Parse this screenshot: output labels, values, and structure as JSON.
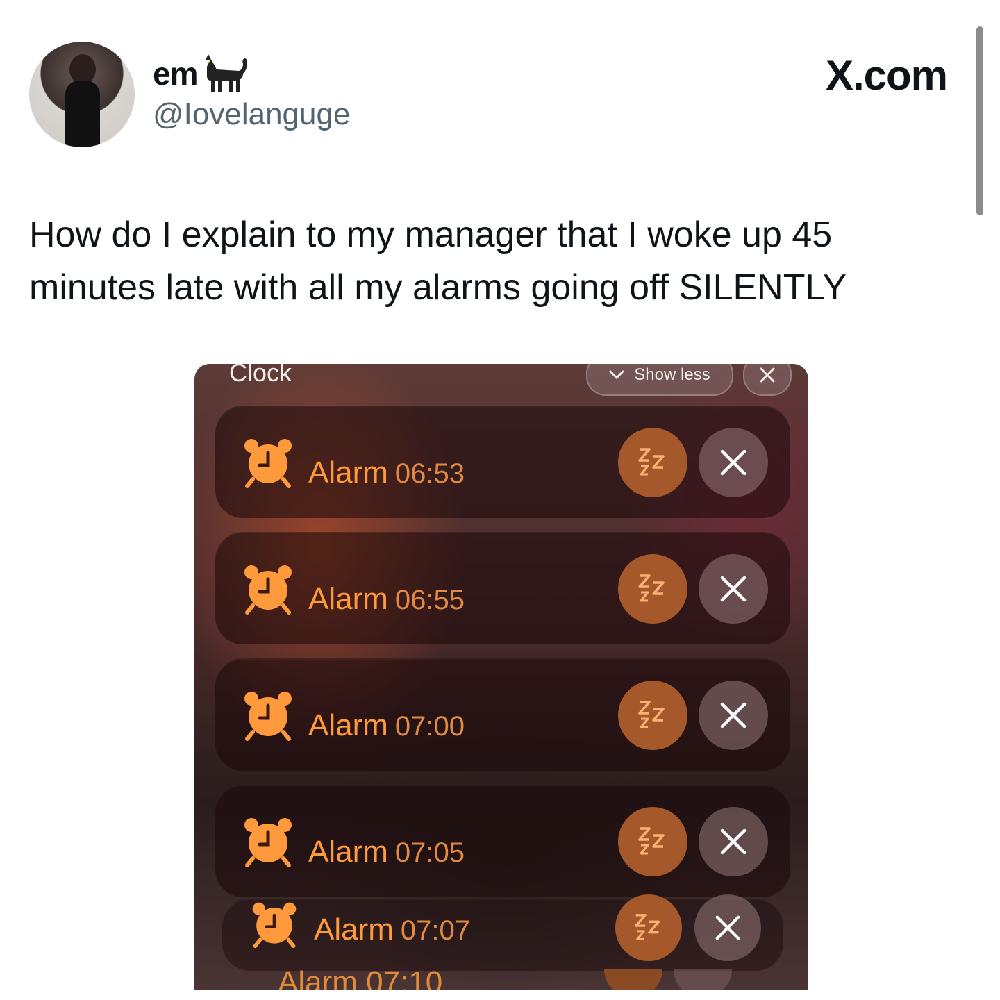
{
  "profile": {
    "display_name": "em",
    "name_emoji_icon": "black-cat-icon",
    "handle": "@Iovelanguge",
    "avatar_icon": "profile-photo"
  },
  "brand": {
    "label": "X.com"
  },
  "tweet": {
    "text": "How do I explain to my manager that I woke up 45 minutes late with all my alarms going off SILENTLY"
  },
  "screenshot": {
    "app_title": "Clock",
    "show_less_label": "Show less",
    "colors": {
      "accent": "#ff9a3c",
      "snooze_bg": "#a5592a"
    },
    "alarms": [
      {
        "label": "Alarm",
        "time": "06:53"
      },
      {
        "label": "Alarm",
        "time": "06:55"
      },
      {
        "label": "Alarm",
        "time": "07:00"
      },
      {
        "label": "Alarm",
        "time": "07:05"
      },
      {
        "label": "Alarm",
        "time": "07:07"
      }
    ],
    "peek_label": "Alarm 07:10"
  }
}
